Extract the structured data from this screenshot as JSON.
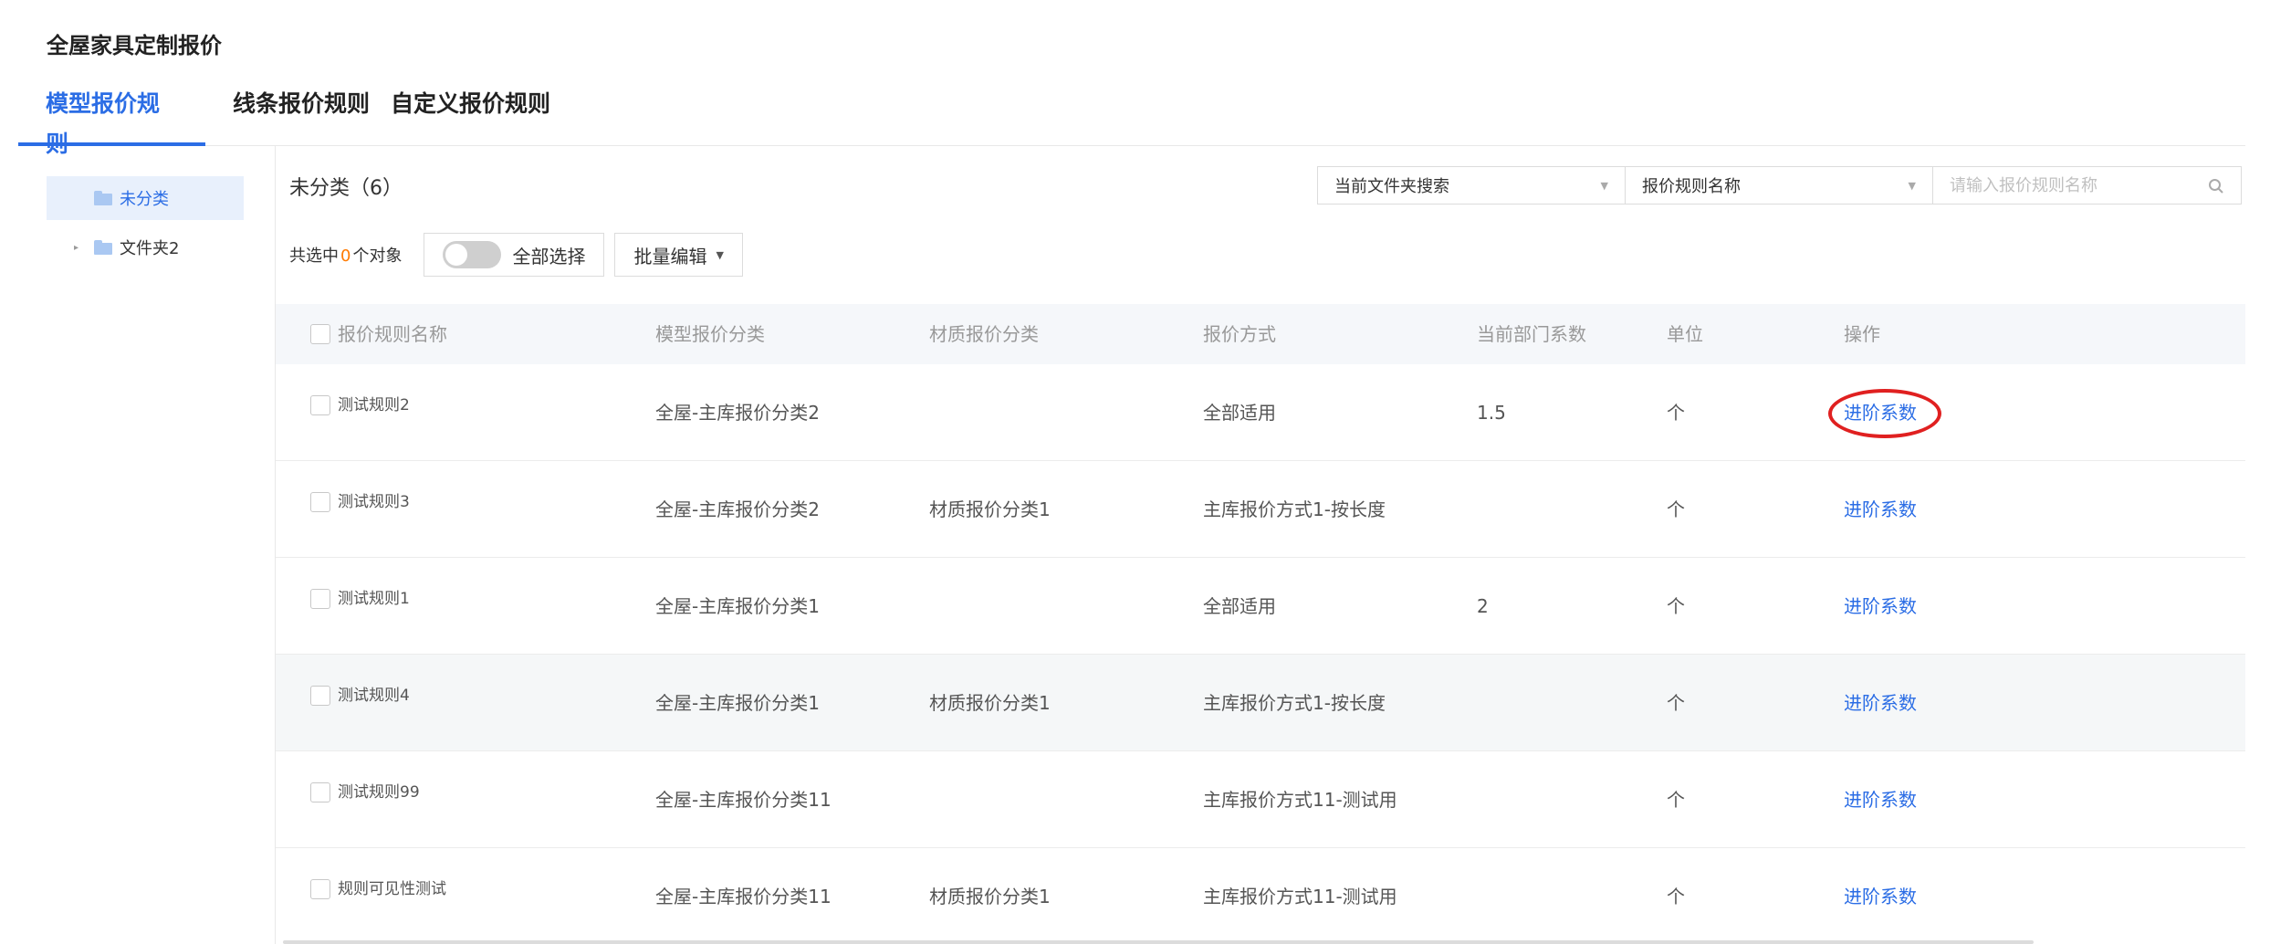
{
  "app_title": "全屋家具定制报价",
  "tabs": [
    {
      "label": "模型报价规则",
      "active": true
    },
    {
      "label": "线条报价规则",
      "active": false
    },
    {
      "label": "自定义报价规则",
      "active": false
    }
  ],
  "sidebar": {
    "items": [
      {
        "label": "未分类",
        "selected": true,
        "icon": "folder-icon"
      },
      {
        "label": "文件夹2",
        "selected": false,
        "icon": "folder-icon",
        "expandable": true
      }
    ]
  },
  "main": {
    "folder_title": "未分类（6）",
    "search": {
      "scope_select": "当前文件夹搜索",
      "field_select": "报价规则名称",
      "placeholder": "请输入报价规则名称"
    },
    "selection": {
      "prefix": "共选中",
      "count": "0",
      "suffix": "个对象",
      "select_all_label": "全部选择",
      "batch_edit_label": "批量编辑"
    },
    "table": {
      "headers": [
        "报价规则名称",
        "模型报价分类",
        "材质报价分类",
        "报价方式",
        "当前部门系数",
        "单位",
        "操作"
      ],
      "rows": [
        {
          "name": "测试规则2",
          "model_cat": "全屋-主库报价分类2",
          "material_cat": "",
          "method": "全部适用",
          "coef": "1.5",
          "unit": "个",
          "action": "进阶系数"
        },
        {
          "name": "测试规则3",
          "model_cat": "全屋-主库报价分类2",
          "material_cat": "材质报价分类1",
          "method": "主库报价方式1-按长度",
          "coef": "",
          "unit": "个",
          "action": "进阶系数"
        },
        {
          "name": "测试规则1",
          "model_cat": "全屋-主库报价分类1",
          "material_cat": "",
          "method": "全部适用",
          "coef": "2",
          "unit": "个",
          "action": "进阶系数"
        },
        {
          "name": "测试规则4",
          "model_cat": "全屋-主库报价分类1",
          "material_cat": "材质报价分类1",
          "method": "主库报价方式1-按长度",
          "coef": "",
          "unit": "个",
          "action": "进阶系数"
        },
        {
          "name": "测试规则99",
          "model_cat": "全屋-主库报价分类11",
          "material_cat": "",
          "method": "主库报价方式11-测试用",
          "coef": "",
          "unit": "个",
          "action": "进阶系数"
        },
        {
          "name": "规则可见性测试",
          "model_cat": "全屋-主库报价分类11",
          "material_cat": "材质报价分类1",
          "method": "主库报价方式11-测试用",
          "coef": "",
          "unit": "个",
          "action": "进阶系数"
        }
      ]
    }
  },
  "colors": {
    "accent": "#2b6de5",
    "count_highlight": "#ff7a00",
    "annotation_circle": "#e02020"
  }
}
